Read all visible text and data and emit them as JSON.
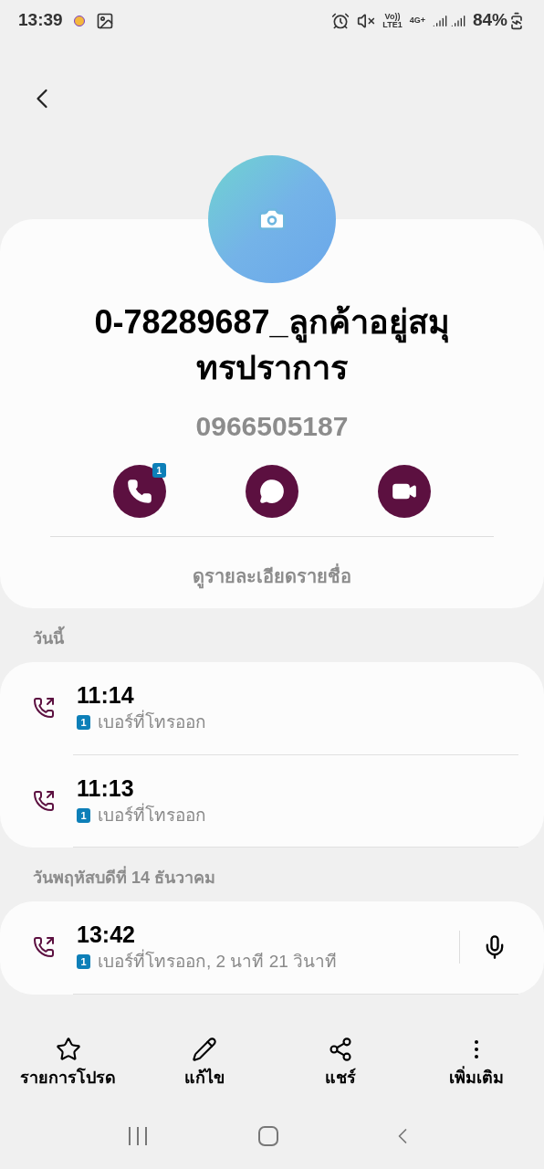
{
  "status_bar": {
    "time": "13:39",
    "volte": "Vo))",
    "lte": "LTE1",
    "network": "4G+",
    "battery": "84%"
  },
  "contact": {
    "name": "0-78289687_ลูกค้าอยู่สมุทรปราการ",
    "number": "0966505187",
    "view_details": "ดูรายละเอียดรายชื่อ"
  },
  "actions": [
    {
      "kind": "call",
      "badge": "1"
    },
    {
      "kind": "message"
    },
    {
      "kind": "video"
    }
  ],
  "history": [
    {
      "date": "วันนี้",
      "calls": [
        {
          "time": "11:14",
          "sim": "1",
          "detail": "เบอร์ที่โทรออก",
          "recording": false
        },
        {
          "time": "11:13",
          "sim": "1",
          "detail": "เบอร์ที่โทรออก",
          "recording": false
        }
      ]
    },
    {
      "date": "วันพฤหัสบดีที่ 14 ธันวาคม",
      "calls": [
        {
          "time": "13:42",
          "sim": "1",
          "detail": "เบอร์ที่โทรออก, 2 นาที 21 วินาที",
          "recording": true
        }
      ]
    }
  ],
  "bottom_bar": [
    {
      "kind": "favorite",
      "label": "รายการโปรด"
    },
    {
      "kind": "edit",
      "label": "แก้ไข"
    },
    {
      "kind": "share",
      "label": "แชร์"
    },
    {
      "kind": "more",
      "label": "เพิ่มเติม"
    }
  ]
}
